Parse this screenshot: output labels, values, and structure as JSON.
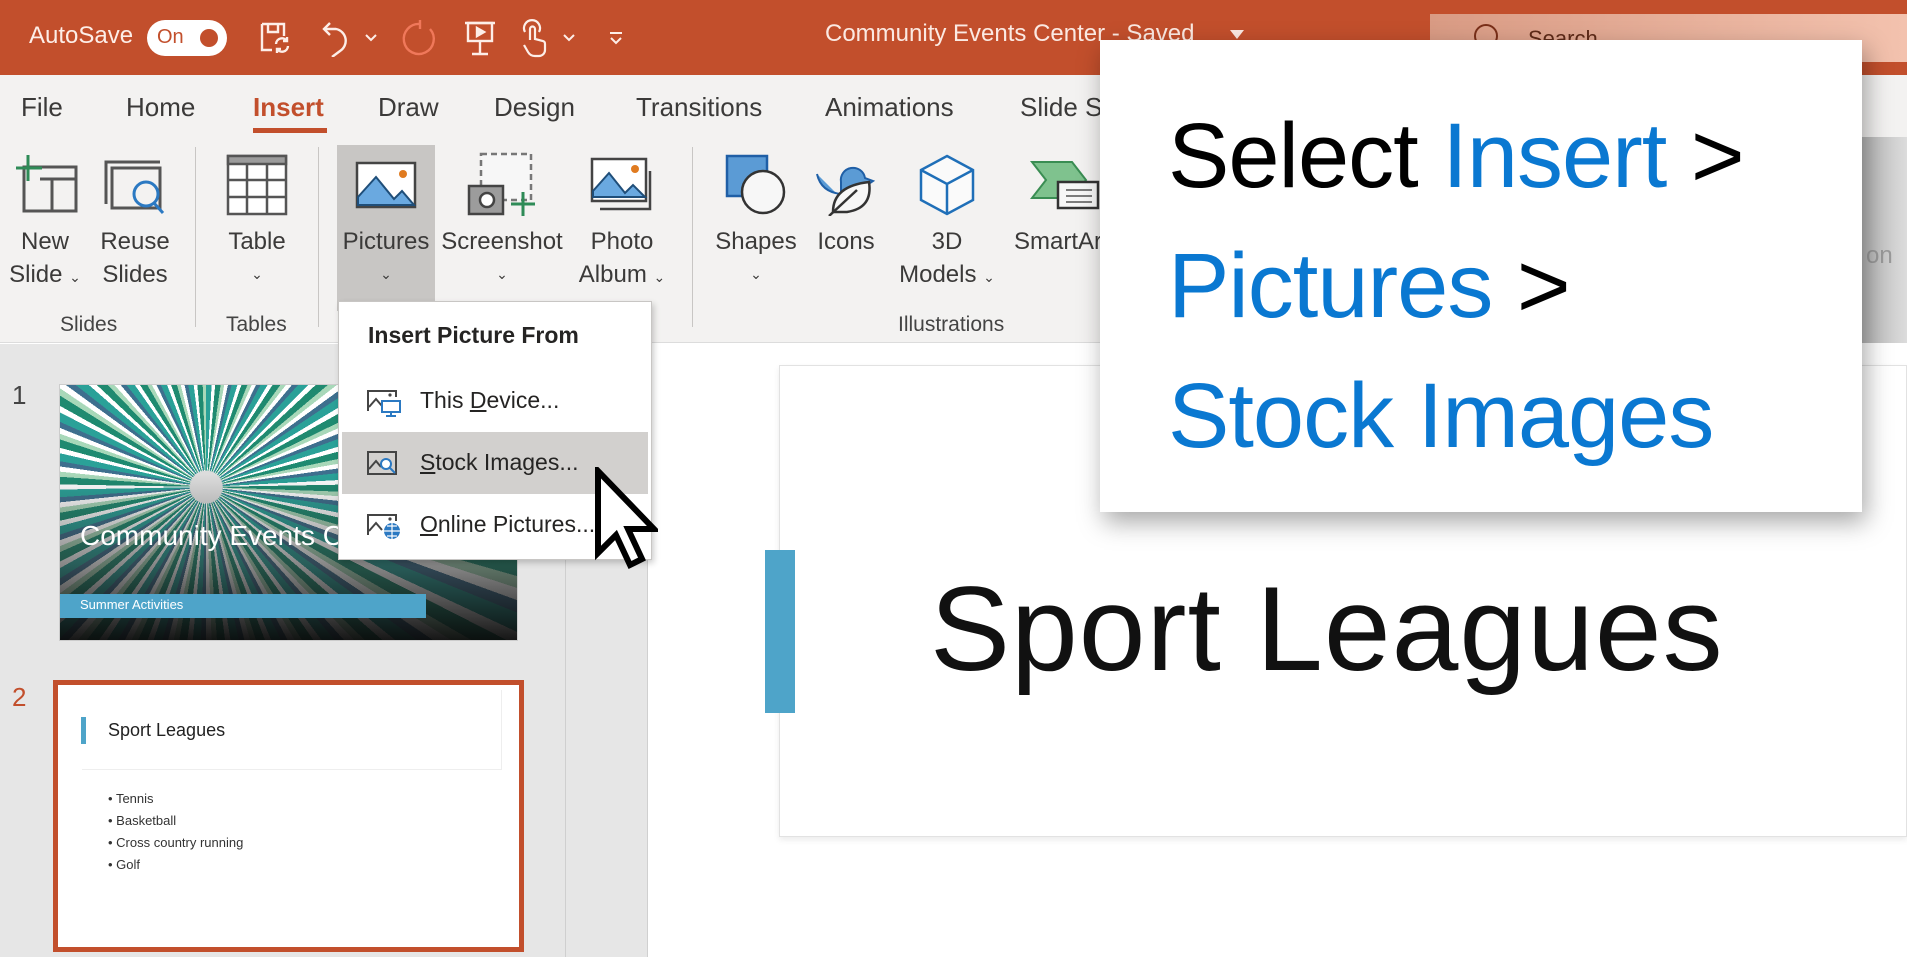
{
  "titlebar": {
    "autosave_label": "AutoSave",
    "autosave_state": "On",
    "document_title": "Community Events Center  -  Saved",
    "search_placeholder": "Search",
    "accent_color": "#c24f2c"
  },
  "quick_access": [
    "save-sync-icon",
    "undo-icon",
    "undo-dropdown",
    "redo-icon",
    "present-icon",
    "touch-mode-icon",
    "touch-dropdown",
    "customize-qat-icon"
  ],
  "tabs": [
    "File",
    "Home",
    "Insert",
    "Draw",
    "Design",
    "Transitions",
    "Animations",
    "Slide S"
  ],
  "active_tab": "Insert",
  "ribbon": {
    "slides_group": {
      "label": "Slides",
      "new_slide": [
        "New",
        "Slide"
      ],
      "reuse_slides": [
        "Reuse",
        "Slides"
      ]
    },
    "tables_group": {
      "label": "Tables",
      "table": "Table"
    },
    "images_group": {
      "pictures": "Pictures",
      "screenshot": "Screenshot",
      "photo_album": [
        "Photo",
        "Album"
      ]
    },
    "illustrations_group": {
      "label": "Illustrations",
      "shapes": "Shapes",
      "icons": "Icons",
      "models": [
        "3D",
        "Models"
      ],
      "smartart": "SmartAr"
    },
    "clipped_right_label": "on"
  },
  "pictures_menu": {
    "header": "Insert Picture From",
    "items": [
      {
        "pre": "This ",
        "accel": "D",
        "post": "evice..."
      },
      {
        "pre": "",
        "accel": "S",
        "post": "tock Images..."
      },
      {
        "pre": "",
        "accel": "O",
        "post": "nline Pictures..."
      }
    ],
    "hovered_index": 1
  },
  "slides": [
    {
      "number": "1",
      "title": "Community Events Center",
      "subtitle": "Summer Activities"
    },
    {
      "number": "2",
      "title": "Sport Leagues",
      "bullets": [
        "Tennis",
        "Basketball",
        "Cross country running",
        "Golf"
      ],
      "selected": true
    }
  ],
  "main_slide": {
    "title": "Sport Leagues"
  },
  "callout": {
    "line1": {
      "black": "Select ",
      "blue": "Insert",
      "tail": " >"
    },
    "line2": {
      "blue": "Pictures",
      "tail": " >"
    },
    "line3": {
      "blue": "Stock Images"
    }
  }
}
